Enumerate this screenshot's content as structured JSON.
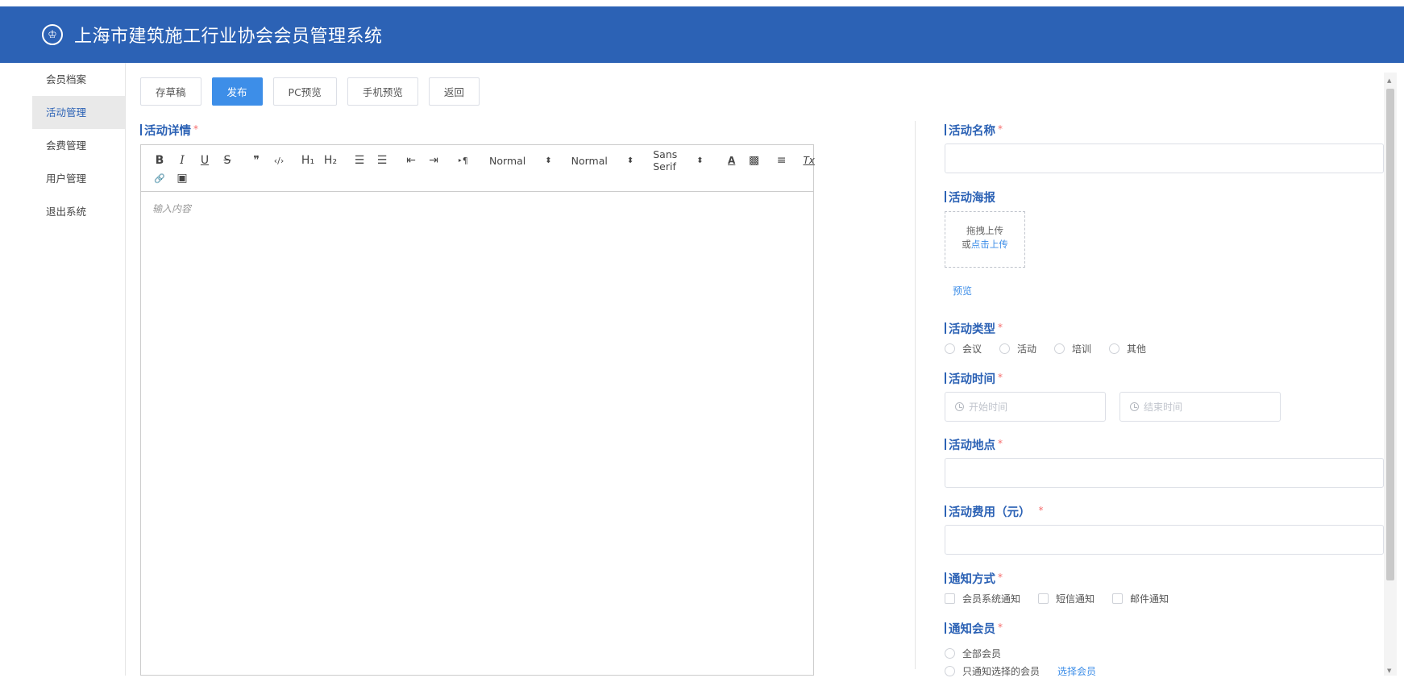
{
  "header": {
    "title": "上海市建筑施工行业协会会员管理系统",
    "logo_icon": "association-logo-icon",
    "bg_color": "#2c62b5"
  },
  "sidebar": {
    "items": [
      {
        "label": "会员档案",
        "active": false
      },
      {
        "label": "活动管理",
        "active": true
      },
      {
        "label": "会费管理",
        "active": false
      },
      {
        "label": "用户管理",
        "active": false
      },
      {
        "label": "退出系统",
        "active": false
      }
    ]
  },
  "actions": {
    "draft": "存草稿",
    "publish": "发布",
    "pc_preview": "PC预览",
    "mobile_preview": "手机预览",
    "back": "返回"
  },
  "editor": {
    "section_title": "活动详情",
    "required_mark": "*",
    "placeholder": "输入内容",
    "toolbar": {
      "bold": "B",
      "italic": "I",
      "underline": "U",
      "strike": "S",
      "blockquote": "❞",
      "code": "‹/›",
      "h1": "H₁",
      "h2": "H₂",
      "ordered_list": "☰",
      "bullet_list": "☰",
      "outdent": "⇤",
      "indent": "⇥",
      "direction": "‣¶",
      "size_picker": "Normal",
      "header_picker": "Normal",
      "font_picker": "Sans Serif",
      "color": "A",
      "background": "▩",
      "align": "≡",
      "clean": "Tx",
      "link": "🔗",
      "image": "▣"
    }
  },
  "form": {
    "name": {
      "label": "活动名称",
      "value": ""
    },
    "poster": {
      "label": "活动海报",
      "drag_text": "拖拽上传",
      "or_text": "或",
      "click_text": "点击上传",
      "preview": "预览"
    },
    "type": {
      "label": "活动类型",
      "options": [
        "会议",
        "活动",
        "培训",
        "其他"
      ]
    },
    "time": {
      "label": "活动时间",
      "start_placeholder": "开始时间",
      "end_placeholder": "结束时间"
    },
    "location": {
      "label": "活动地点",
      "value": ""
    },
    "fee": {
      "label": "活动费用（元）",
      "value": ""
    },
    "notify_method": {
      "label": "通知方式",
      "options": [
        "会员系统通知",
        "短信通知",
        "邮件通知"
      ]
    },
    "notify_members": {
      "label": "通知会员",
      "options": [
        "全部会员",
        "只通知选择的会员"
      ],
      "select_link": "选择会员"
    }
  }
}
